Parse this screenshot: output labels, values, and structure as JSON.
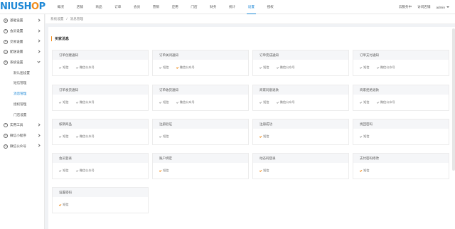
{
  "logo": {
    "main": "NIUSH",
    "accent": "O",
    "tail": "P"
  },
  "topnav": [
    "概况",
    "店铺",
    "商品",
    "订单",
    "会员",
    "营销",
    "应用",
    "门店",
    "财务",
    "统计",
    "设置",
    "授权"
  ],
  "topnav_active": 10,
  "topright": {
    "link1": "云服务中",
    "link2": "访问店铺",
    "user": "admin"
  },
  "sidebar": {
    "items": [
      {
        "label": "基础设置",
        "icon": "⚙"
      },
      {
        "label": "会员设置",
        "icon": "☺"
      },
      {
        "label": "交易设置",
        "icon": "$"
      },
      {
        "label": "配送设置",
        "icon": "▭"
      },
      {
        "label": "系统设置",
        "icon": "⚙"
      }
    ],
    "submenu": [
      "默认图设置",
      "短信管理",
      "消息管理",
      "授权管理",
      "门店设置"
    ],
    "submenu_active": 2,
    "items_after": [
      {
        "label": "实用工具",
        "icon": "✎"
      },
      {
        "label": "微信小程序",
        "icon": "◎"
      },
      {
        "label": "微信公众号",
        "icon": "◎"
      }
    ]
  },
  "breadcrumb": {
    "level1": "系统设置",
    "sep": "/",
    "level2": "消息管理"
  },
  "section_title": "买家消息",
  "labels": {
    "sms": "短信",
    "wechat": "微信公众号"
  },
  "cards": [
    {
      "title": "订单创建通知",
      "sms_on": false,
      "wechat": true,
      "wechat_on": false
    },
    {
      "title": "订单关闭通知",
      "sms_on": false,
      "wechat": true,
      "wechat_on": true
    },
    {
      "title": "订单完成通知",
      "sms_on": false,
      "wechat": true,
      "wechat_on": false
    },
    {
      "title": "订单支付通知",
      "sms_on": false,
      "wechat": true,
      "wechat_on": false
    },
    {
      "title": "订单发货通知",
      "sms_on": false,
      "wechat": true,
      "wechat_on": false
    },
    {
      "title": "订单收货通知",
      "sms_on": false,
      "wechat": true,
      "wechat_on": false
    },
    {
      "title": "商家同意退款",
      "sms_on": false,
      "wechat": true,
      "wechat_on": false
    },
    {
      "title": "商家拒绝退款",
      "sms_on": false,
      "wechat": true,
      "wechat_on": false
    },
    {
      "title": "核销商品",
      "sms_on": false,
      "wechat": true,
      "wechat_on": false
    },
    {
      "title": "注册验证",
      "sms_on": false,
      "wechat": false
    },
    {
      "title": "注册成功",
      "sms_on": true,
      "wechat": false
    },
    {
      "title": "找回密码",
      "sms_on": false,
      "wechat": false
    },
    {
      "title": "会员登录",
      "sms_on": false,
      "wechat": true,
      "wechat_on": false
    },
    {
      "title": "账户绑定",
      "sms_on": true,
      "wechat": false
    },
    {
      "title": "动态码登录",
      "sms_on": true,
      "wechat": false
    },
    {
      "title": "支付密码修改",
      "sms_on": true,
      "wechat": false
    },
    {
      "title": "设置密码",
      "sms_on": true,
      "wechat": false
    }
  ]
}
